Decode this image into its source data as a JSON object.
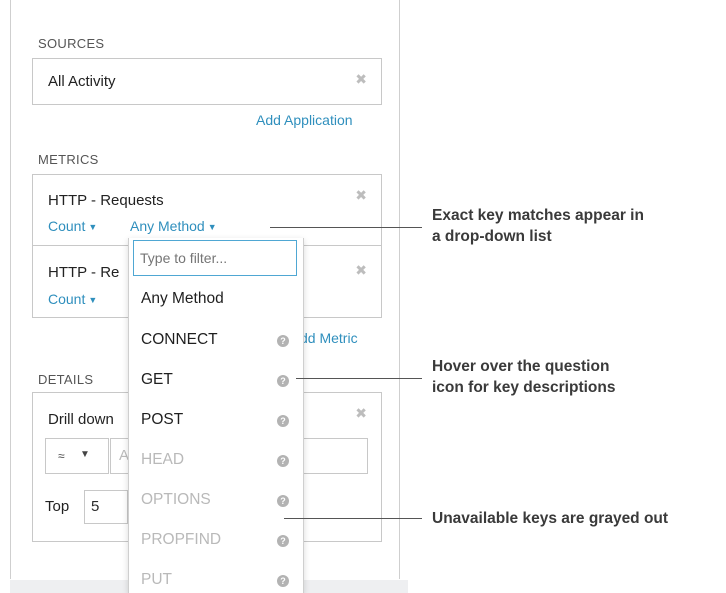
{
  "sources": {
    "title": "SOURCES",
    "value": "All Activity",
    "clear_icon": "close-icon",
    "add_link": "Add Application"
  },
  "metrics": {
    "title": "METRICS",
    "items": [
      {
        "name": "HTTP - Requests",
        "agg": "Count",
        "method": "Any Method"
      },
      {
        "name": "HTTP - Re",
        "agg": "Count"
      }
    ],
    "add_link": "dd Metric"
  },
  "details": {
    "title": "DETAILS",
    "drill_label": "Drill down",
    "operator": "≈",
    "field_partial": "A",
    "top_label": "Top",
    "top_value": "5"
  },
  "dropdown": {
    "placeholder": "Type to filter...",
    "options": [
      {
        "label": "Any Method",
        "available": true,
        "help": false
      },
      {
        "label": "CONNECT",
        "available": true,
        "help": true
      },
      {
        "label": "GET",
        "available": true,
        "help": true
      },
      {
        "label": "POST",
        "available": true,
        "help": true
      },
      {
        "label": "HEAD",
        "available": false,
        "help": true
      },
      {
        "label": "OPTIONS",
        "available": false,
        "help": true
      },
      {
        "label": "PROPFIND",
        "available": false,
        "help": true
      },
      {
        "label": "PUT",
        "available": false,
        "help": true
      }
    ]
  },
  "callouts": [
    {
      "line1": "Exact key matches appear in",
      "line2": "a drop-down list"
    },
    {
      "line1": "Hover over the question",
      "line2": "icon for key descriptions"
    },
    {
      "line1": "Unavailable keys are grayed out",
      "line2": ""
    }
  ],
  "colors": {
    "link": "#2f8fbd",
    "accent_border": "#4fa7d3",
    "gray_text": "#b9b9b9"
  }
}
